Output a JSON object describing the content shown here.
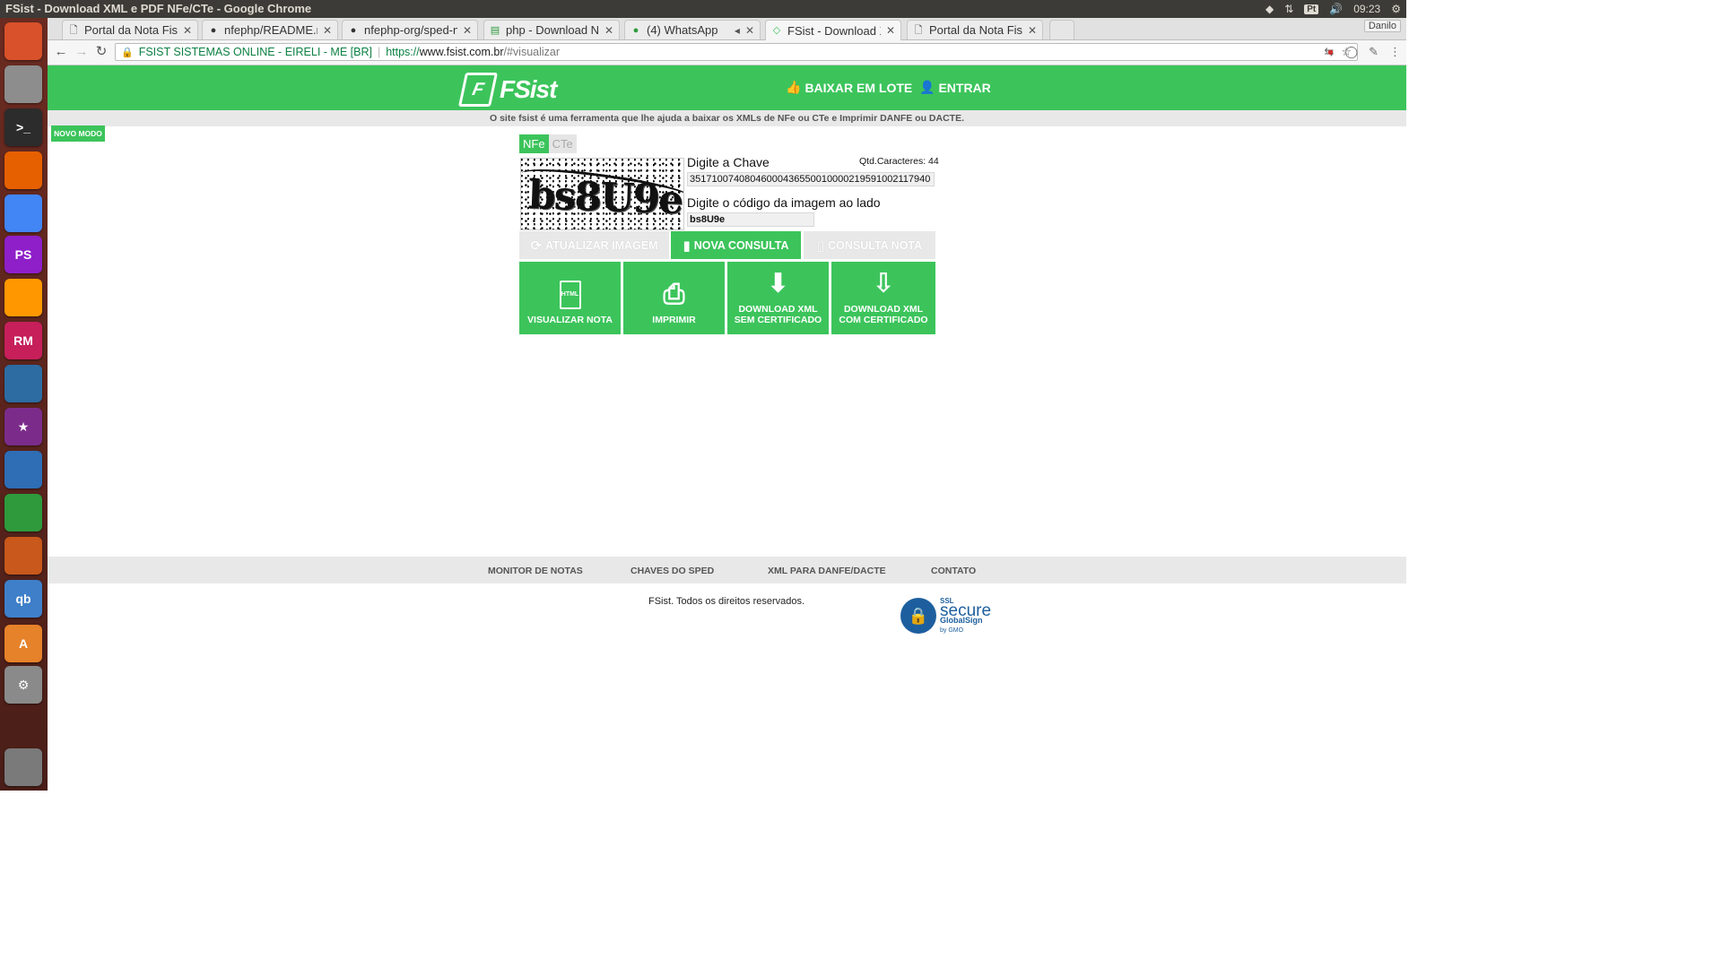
{
  "window": {
    "title": "FSist - Download XML e PDF NFe/CTe - Google Chrome",
    "tray": {
      "lang": "Pt",
      "time": "09:23"
    }
  },
  "launcher": {
    "items": [
      {
        "name": "ubuntu-dash",
        "label": "",
        "color": "#d8512a"
      },
      {
        "name": "files",
        "label": "",
        "color": "#8d8d8d"
      },
      {
        "name": "terminal",
        "label": ">_",
        "color": "#2c2c2c"
      },
      {
        "name": "firefox",
        "label": "",
        "color": "#e66000"
      },
      {
        "name": "chrome",
        "label": "",
        "color": "#4285f4"
      },
      {
        "name": "phpstorm",
        "label": "PS",
        "color": "#8e1fc9"
      },
      {
        "name": "sublime",
        "label": "",
        "color": "#ff9800"
      },
      {
        "name": "rubymine",
        "label": "RM",
        "color": "#c61f5a"
      },
      {
        "name": "mysql-workbench",
        "label": "",
        "color": "#2d6ca2"
      },
      {
        "name": "starred-app",
        "label": "★",
        "color": "#7b2c8a"
      },
      {
        "name": "writer",
        "label": "",
        "color": "#2f6db5"
      },
      {
        "name": "calc",
        "label": "",
        "color": "#2e9a3c"
      },
      {
        "name": "impress",
        "label": "",
        "color": "#c8581b"
      },
      {
        "name": "qbittorrent",
        "label": "qb",
        "color": "#3f7fc9"
      },
      {
        "name": "software-center",
        "label": "A",
        "color": "#e6822a"
      },
      {
        "name": "system-settings",
        "label": "⚙",
        "color": "#8a8a8a"
      },
      {
        "name": "trash",
        "label": "",
        "color": "#7a7a7a"
      }
    ]
  },
  "browser": {
    "tabs": [
      {
        "label": "Portal da Nota Fisca",
        "icon": "document-icon"
      },
      {
        "label": "nfephp/README.m",
        "icon": "github-icon"
      },
      {
        "label": "nfephp-org/sped-n",
        "icon": "github-icon"
      },
      {
        "label": "php - Download NF",
        "icon": "stackoverflow-icon"
      },
      {
        "label": "(4) WhatsApp",
        "icon": "whatsapp-icon"
      },
      {
        "label": "FSist - Download X",
        "icon": "fsist-icon"
      },
      {
        "label": "Portal da Nota Fisca",
        "icon": "document-icon"
      }
    ],
    "profile": "Danilo",
    "address": {
      "ev_name": "FSIST SISTEMAS ONLINE - EIRELI - ME [BR]",
      "scheme": "https://",
      "host": "www.fsist.com.br",
      "path": "/#visualizar"
    }
  },
  "site": {
    "brand": "FSist",
    "nav": {
      "batch": "BAIXAR EM LOTE",
      "login": "ENTRAR"
    },
    "tagline": "O site fsist é uma ferramenta que lhe ajuda a baixar os XMLs de NFe ou CTe e Imprimir DANFE ou DACTE.",
    "novo_modo": "NOVO MODO",
    "doc_tabs": {
      "nfe": "NFe",
      "cte": "CTe"
    },
    "form": {
      "key_label": "Digite a Chave",
      "qtd_label": "Qtd.Caracteres: 44",
      "key_value": "35171007408046000436550010000219591002117940",
      "captcha_label": "Digite o código da imagem ao lado",
      "captcha_value": "bs8U9e",
      "captcha_image_text": "bs8U9e"
    },
    "actions": {
      "refresh": "ATUALIZAR IMAGEM",
      "new": "NOVA CONSULTA",
      "query": "CONSULTA NOTA"
    },
    "big_buttons": {
      "view": "VISUALIZAR NOTA",
      "print": "IMPRIMIR",
      "xml_no_cert_1": "DOWNLOAD XML",
      "xml_no_cert_2": "SEM CERTIFICADO",
      "xml_cert_1": "DOWNLOAD XML",
      "xml_cert_2": "COM CERTIFICADO"
    },
    "footer": {
      "links": [
        "MONITOR DE NOTAS",
        "CHAVES DO SPED",
        "XML PARA DANFE/DACTE",
        "CONTATO"
      ],
      "copyright": "FSist. Todos os direitos reservados.",
      "ssl": {
        "secure": "secure",
        "brand": "GlobalSign",
        "by": "by GMO",
        "badge": "SSL"
      }
    }
  },
  "colors": {
    "brand_green": "#3cc45b",
    "launcher_bg": "#5a2419",
    "panel": "#3c3b37"
  }
}
